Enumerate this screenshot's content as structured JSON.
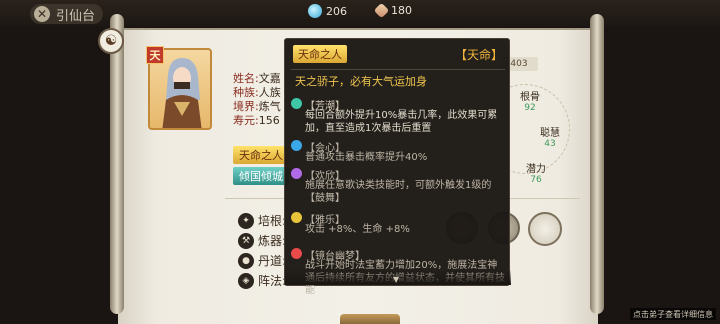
{
  "topbar": {
    "back_label": "引仙台",
    "currency": [
      {
        "icon": "spirit-stone-icon",
        "value": "206"
      },
      {
        "icon": "gem-icon",
        "value": "180"
      }
    ]
  },
  "character": {
    "rank_badge": "天",
    "info": [
      {
        "key": "姓名:",
        "value": "文嘉"
      },
      {
        "key": "种族:",
        "value": "人族"
      },
      {
        "key": "境界:",
        "value": "炼气"
      },
      {
        "key": "寿元:",
        "value": "156"
      }
    ],
    "tags": [
      "天命之人",
      "倾国倾城"
    ],
    "skills": [
      {
        "icon": "cultivation-icon",
        "label": "培根:"
      },
      {
        "icon": "alchemy-icon",
        "label": "炼器:"
      },
      {
        "icon": "pill-icon",
        "label": "丹道:"
      },
      {
        "icon": "formation-icon",
        "label": "阵法:"
      }
    ]
  },
  "stats": {
    "id_text": "403",
    "items": [
      {
        "name": "根骨",
        "value": "92"
      },
      {
        "name": "聪慧",
        "value": "43"
      },
      {
        "name": "潜力",
        "value": "76"
      }
    ]
  },
  "tooltip": {
    "name": "天命之人",
    "type": "【天命】",
    "desc": "天之骄子，必有大气运加身",
    "traits": [
      {
        "name": "【芳潮】",
        "icon": "tide-icon",
        "color": "#3ec6a6",
        "text": "每回合额外提升10%暴击几率，此效果可累加，直至造成1次暴击后重置",
        "dim": false
      },
      {
        "name": "【会心】",
        "icon": "heart-mind-icon",
        "color": "#3aa8e8",
        "text": "普通攻击暴击概率提升40%",
        "dim": true
      },
      {
        "name": "【欢欣】",
        "icon": "joy-icon",
        "color": "#b16be8",
        "text": "施展任意歌诀类技能时，可额外触发1级的【鼓舞】",
        "dim": true
      },
      {
        "name": "【雅乐】",
        "icon": "music-icon",
        "color": "#e8c43a",
        "text": "攻击 +8%、生命 +8%",
        "dim": true
      },
      {
        "name": "【镜台幽梦】",
        "icon": "mirror-dream-icon",
        "color": "#e84a4a",
        "text": "战斗开始时法宝蓄力增加20%，施展法宝神通后持续所有友方的增益状态，并使其所有技能",
        "dim": true
      }
    ]
  },
  "bottom_hint": "点击弟子查看详细信息"
}
